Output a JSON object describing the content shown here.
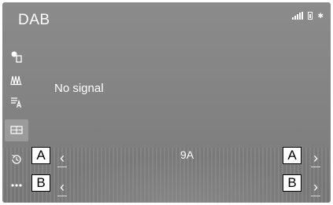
{
  "header": {
    "title": "DAB",
    "status_icons": [
      "signal-strength-icon",
      "phone-battery-icon",
      "bluetooth-icon"
    ],
    "bluetooth_glyph": "✱"
  },
  "sidebar": {
    "items": [
      {
        "name": "source-icon",
        "active": false
      },
      {
        "name": "station-list-icon",
        "active": false
      },
      {
        "name": "category-list-icon",
        "active": false
      },
      {
        "name": "preset-icon",
        "active": true
      },
      {
        "name": "time-shift-icon",
        "active": false
      },
      {
        "name": "more-options-icon",
        "active": false
      }
    ]
  },
  "main": {
    "status_text": "No signal",
    "channel": "9A",
    "prev_glyph": "‹",
    "next_glyph": "›"
  },
  "callouts": {
    "a": "A",
    "b": "B"
  },
  "colors": {
    "screen_bg": "#858585",
    "text": "#ffffff",
    "active_tab": "#9b9b9b"
  }
}
